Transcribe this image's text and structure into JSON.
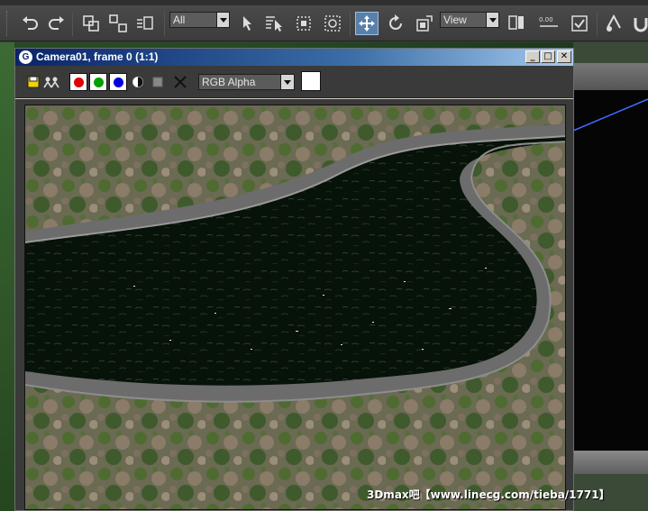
{
  "toolbar": {
    "selection_filter": "All",
    "reference_coord": "View",
    "icons": [
      "undo-icon",
      "redo-icon",
      "link-icon",
      "unlink-icon",
      "bind-spacewarp-icon",
      "select-object-icon",
      "select-by-name-icon",
      "rectangle-selection-icon",
      "window-crossing-icon",
      "select-move-icon",
      "select-rotate-icon",
      "select-scale-icon",
      "pivot-icon",
      "mirror-icon",
      "align-icon",
      "manage-layers-icon",
      "magnet-icon"
    ]
  },
  "frame_window": {
    "title": "Camera01, frame 0 (1:1)",
    "title_icon": "3ds-max-logo-icon",
    "minimize": "_",
    "maximize": "□",
    "close": "✕",
    "channel_display": "RGB Alpha",
    "red_channel_color": "#e00000",
    "green_channel_color": "#00a000",
    "blue_channel_color": "#0000e0"
  },
  "watermark": "3Dmax吧【www.linecg.com/tieba/1771】"
}
